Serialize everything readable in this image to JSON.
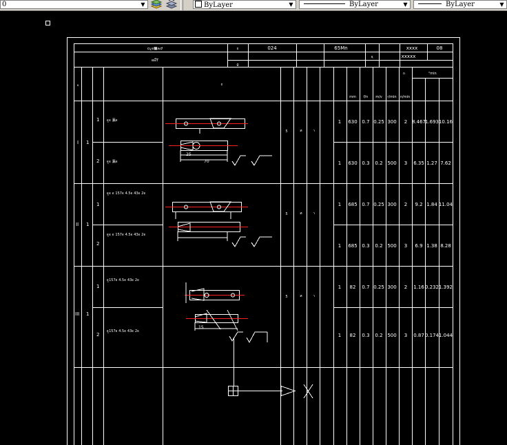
{
  "toolbar": {
    "layer_value": "0",
    "color_value": "ByLayer",
    "linetype_value": "ByLayer",
    "lineweight_value": "ByLayer"
  },
  "sheet": {
    "header": {
      "title_l1": "ѻ¿ϵ׾̸ѧԺ",
      "title_l2": "еӹ̿Ƭ",
      "part_no_label": "ͼ",
      "part_no_value": "024",
      "name_label": "",
      "material_label": "ϱ",
      "material_value": "",
      "weight_label": "",
      "process_label": "",
      "page_label": "",
      "sheet_label": "ҳ",
      "code_value": "65Mn",
      "qty_label": "",
      "xxxx_1": "xxxx",
      "num_08": "08",
      "xxxxx": "xxxxx"
    },
    "col_heads": {
      "c1": "װ",
      "c2": "",
      "c3": "",
      "step_name": "",
      "sketch": "ͼ",
      "c6": "",
      "c7": "",
      "c8": "",
      "c9": "",
      "c10": "",
      "speed": "",
      "depth": "",
      "feed": "",
      "vel": "",
      "rpm": "ת",
      "passes": "",
      "time": "ʱmin",
      "time_sub1": "",
      "time_sub2": "",
      "time_sub3": "",
      "u_mm": "mm",
      "u_f": "f/n",
      "u_mv": "m/v",
      "u_rmin": "r/min",
      "u_nmin": "n/min"
    },
    "rows": [
      {
        "roman": "I",
        "install": "1",
        "step": "1",
        "desc": "ϵ̫ϵ 瀛ϵ",
        "tool": "ƽ",
        "gauge": "ͷ",
        "fix": "ר",
        "passes": "1",
        "length": "630",
        "depth": "0.7",
        "feed": "0.25",
        "rpm": "300",
        "n": "2",
        "t1": "8.467",
        "t2": "1.693",
        "t3": "10.16"
      },
      {
        "roman": "",
        "install": "",
        "step": "2",
        "desc": "ϵ̫ϵ 瀛ϵ",
        "tool": "",
        "gauge": "",
        "fix": "",
        "passes": "1",
        "length": "630",
        "depth": "0.3",
        "feed": "0.2",
        "rpm": "500",
        "n": "3",
        "t1": "6.35",
        "t2": "1.27",
        "t3": "7.62"
      },
      {
        "roman": "II",
        "install": "1",
        "step": "1",
        "desc": "ϵ̫ϵ ϵ 157ϵ 4.5ϵ 43ϵ 2ϵ",
        "tool": "ƽ",
        "gauge": "ͷ",
        "fix": "ר",
        "passes": "1",
        "length": "685",
        "depth": "0.7",
        "feed": "0.25",
        "rpm": "300",
        "n": "2",
        "t1": "9.2",
        "t2": "1.84",
        "t3": "11.04"
      },
      {
        "roman": "",
        "install": "",
        "step": "2",
        "desc": "ϵ̫ϵ ϵ 157ϵ 4.5ϵ 43ϵ 2ϵ",
        "tool": "",
        "gauge": "",
        "fix": "",
        "passes": "1",
        "length": "685",
        "depth": "0.3",
        "feed": "0.2",
        "rpm": "500",
        "n": "3",
        "t1": "6.9",
        "t2": "1.38",
        "t3": "8.28"
      },
      {
        "roman": "III",
        "install": "1",
        "step": "1",
        "desc": "ϵ̫157ϵ 4.5ϵ 43ϵ 2ϵ",
        "tool": "ƽ",
        "gauge": "ͷ",
        "fix": "ר",
        "passes": "1",
        "length": "82",
        "depth": "0.7",
        "feed": "0.25",
        "rpm": "300",
        "n": "2",
        "t1": "1.16",
        "t2": "0.232",
        "t3": "1.392"
      },
      {
        "roman": "",
        "install": "",
        "step": "2",
        "desc": "ϵ̫157ϵ 4.5ϵ 43ϵ 2ϵ",
        "tool": "",
        "gauge": "",
        "fix": "",
        "passes": "1",
        "length": "82",
        "depth": "0.3",
        "feed": "0.2",
        "rpm": "500",
        "n": "3",
        "t1": "0.87",
        "t2": "0.174",
        "t3": "1.044"
      }
    ],
    "sketch_dims": {
      "d_70": "70",
      "d_25": "25",
      "d_15": "15"
    }
  },
  "icons": {
    "layer_manager": "layer-stack-icon",
    "layer_prev": "layer-previous-icon",
    "ucs": "ucs-square-icon",
    "crosshair": "crosshair-cursor-icon",
    "arrow": "direction-arrow-icon",
    "x_marker": "x-marker-icon"
  },
  "colors": {
    "background": "#000000",
    "lines": "#ffffff",
    "centerline": "#ff2020",
    "toolbar": "#d4d0c8"
  }
}
